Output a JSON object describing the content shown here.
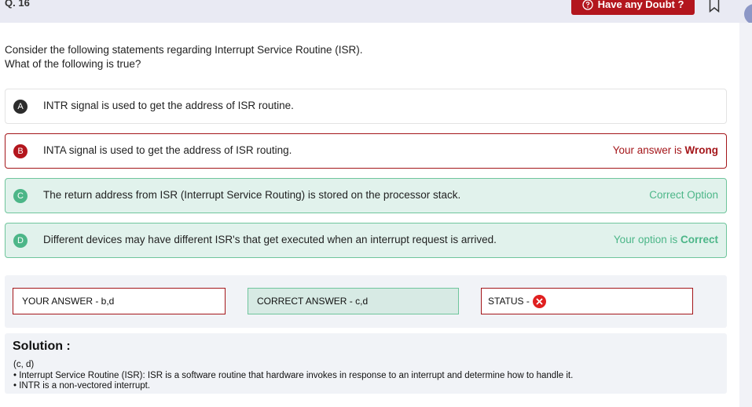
{
  "header": {
    "question_number": "Q. 16",
    "doubt_button": "Have any Doubt ?"
  },
  "question": {
    "line1": "Consider the following statements regarding Interrupt Service Routine (ISR).",
    "line2": "What of the following is true?"
  },
  "options": [
    {
      "letter": "A",
      "text": "INTR signal is used to get the address of ISR routine.",
      "state": "neutral"
    },
    {
      "letter": "B",
      "text": "INTA signal is used to get the address of ISR routing.",
      "state": "wrong",
      "status_prefix": "Your answer is ",
      "status_strong": "Wrong"
    },
    {
      "letter": "C",
      "text": "The return address from ISR (Interrupt Service Routing) is stored on the processor stack.",
      "state": "correct",
      "status_prefix": "Correct Option",
      "status_strong": ""
    },
    {
      "letter": "D",
      "text": "Different devices may have different ISR's that get executed when an interrupt request is arrived.",
      "state": "correct",
      "status_prefix": "Your option is ",
      "status_strong": "Correct"
    }
  ],
  "summary": {
    "your_answer": "YOUR ANSWER - b,d",
    "correct_answer": "CORRECT ANSWER - c,d",
    "status_label": "STATUS -",
    "status_icon": "cross-icon"
  },
  "solution": {
    "title": "Solution :",
    "lines": [
      "(c, d)",
      "• Interrupt Service Routine (ISR): ISR is a software routine that hardware invokes in response to an interrupt and determine how to handle it.",
      "• INTR is a non-vectored interrupt."
    ]
  },
  "colors": {
    "accent_red": "#b3161d",
    "correct_green": "#4cb688",
    "correct_bg": "#e1f2ec"
  }
}
